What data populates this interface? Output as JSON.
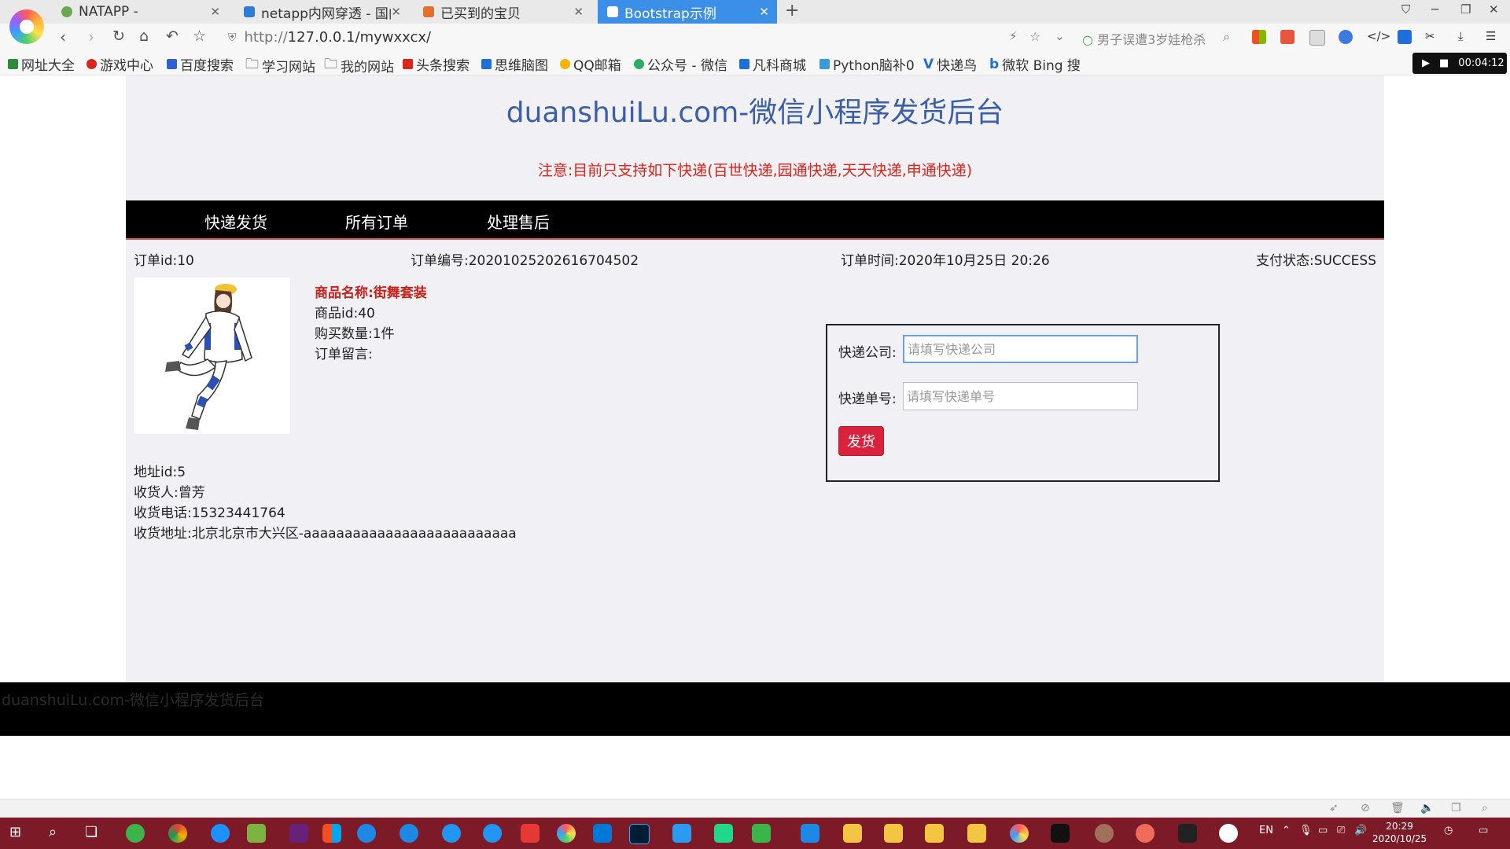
{
  "browser": {
    "tabs": [
      {
        "label": "NATAPP -"
      },
      {
        "label": "netapp内网穿透 - 国内"
      },
      {
        "label": "已买到的宝贝"
      },
      {
        "label": "Bootstrap示例"
      }
    ],
    "url_prefix": "http://",
    "url_host": "127.0.0.1",
    "url_path": "/mywxxcx/",
    "hot_search": "男子误遭3岁娃枪杀",
    "bookmarks": [
      {
        "label": "网址大全"
      },
      {
        "label": "游戏中心"
      },
      {
        "label": "百度搜索"
      },
      {
        "label": "学习网站"
      },
      {
        "label": "我的网站"
      },
      {
        "label": "头条搜索"
      },
      {
        "label": "思维脑图"
      },
      {
        "label": "QQ邮箱"
      },
      {
        "label": "公众号 - 微信"
      },
      {
        "label": "凡科商城"
      },
      {
        "label": "Python脑补0"
      },
      {
        "label": "快递鸟"
      },
      {
        "label": "微软 Bing 搜"
      }
    ],
    "recording_time": "00:04:12"
  },
  "page": {
    "title": "duanshuiLu.com-微信小程序发货后台",
    "notice": "注意:目前只支持如下快递(百世快递,园通快递,天天快递,申通快递)",
    "menu": [
      {
        "label": "快递发货"
      },
      {
        "label": "所有订单"
      },
      {
        "label": "处理售后"
      }
    ]
  },
  "order": {
    "id": "订单id:10",
    "number": "订单编号:20201025202616704502",
    "time": "订单时间:2020年10月25日 20:26",
    "pay_status": "支付状态:SUCCESS",
    "product_name": "商品名称:街舞套装",
    "product_id": "商品id:40",
    "quantity": "购买数量:1件",
    "remark": "订单留言:",
    "address_id": "地址id:5",
    "receiver": "收货人:曾芳",
    "phone": "收货电话:15323441764",
    "address": "收货地址:北京北京市大兴区-aaaaaaaaaaaaaaaaaaaaaaaaaa"
  },
  "shipping_form": {
    "company_label": "快递公司:",
    "company_placeholder": "请填写快递公司",
    "company_value": "",
    "tracking_label": "快递单号:",
    "tracking_placeholder": "请填写快递单号",
    "tracking_value": "",
    "submit_label": "发货"
  },
  "footer": {
    "text": "duanshuiLu.com-微信小程序发货后台"
  },
  "taskbar": {
    "clock_time": "20:29",
    "clock_date": "2020/10/25",
    "ime": "EN"
  }
}
